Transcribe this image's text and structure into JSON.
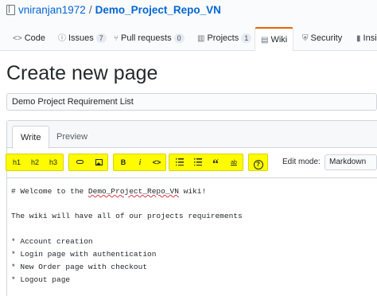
{
  "repo": {
    "owner": "vniranjan1972",
    "separator": "/",
    "name": "Demo_Project_Repo_VN"
  },
  "tabs": [
    {
      "label": "Code",
      "icon": "code-icon"
    },
    {
      "label": "Issues",
      "icon": "issue-icon",
      "count": "7"
    },
    {
      "label": "Pull requests",
      "icon": "pull-request-icon",
      "count": "0"
    },
    {
      "label": "Projects",
      "icon": "project-icon",
      "count": "1"
    },
    {
      "label": "Wiki",
      "icon": "book-icon",
      "selected": true
    },
    {
      "label": "Security",
      "icon": "shield-icon"
    },
    {
      "label": "Insi",
      "icon": "graph-icon"
    }
  ],
  "page": {
    "title": "Create new page"
  },
  "form": {
    "title_value": "Demo Project Requirement List"
  },
  "editor": {
    "write_tab": "Write",
    "preview_tab": "Preview",
    "toolbar": {
      "h1": "h1",
      "h2": "h2",
      "h3": "h3",
      "bold": "B",
      "italic": "i",
      "code": "<>",
      "quote": "“",
      "mention": "ab"
    },
    "edit_mode_label": "Edit mode:",
    "edit_mode_value": "Markdown",
    "content": {
      "line1_prefix": "# Welcome to the ",
      "line1_repo": "Demo_Project_Repo_VN",
      "line1_suffix": " wiki!",
      "line2": "The wiki will have all of our projects requirements",
      "items": [
        "* Account creation",
        "* Login page with authentication",
        "* New Order page with checkout",
        "* Logout page"
      ]
    }
  },
  "colors": {
    "highlight": "#fffb00",
    "link": "#0366d6",
    "selected_tab_accent": "#e36209"
  }
}
